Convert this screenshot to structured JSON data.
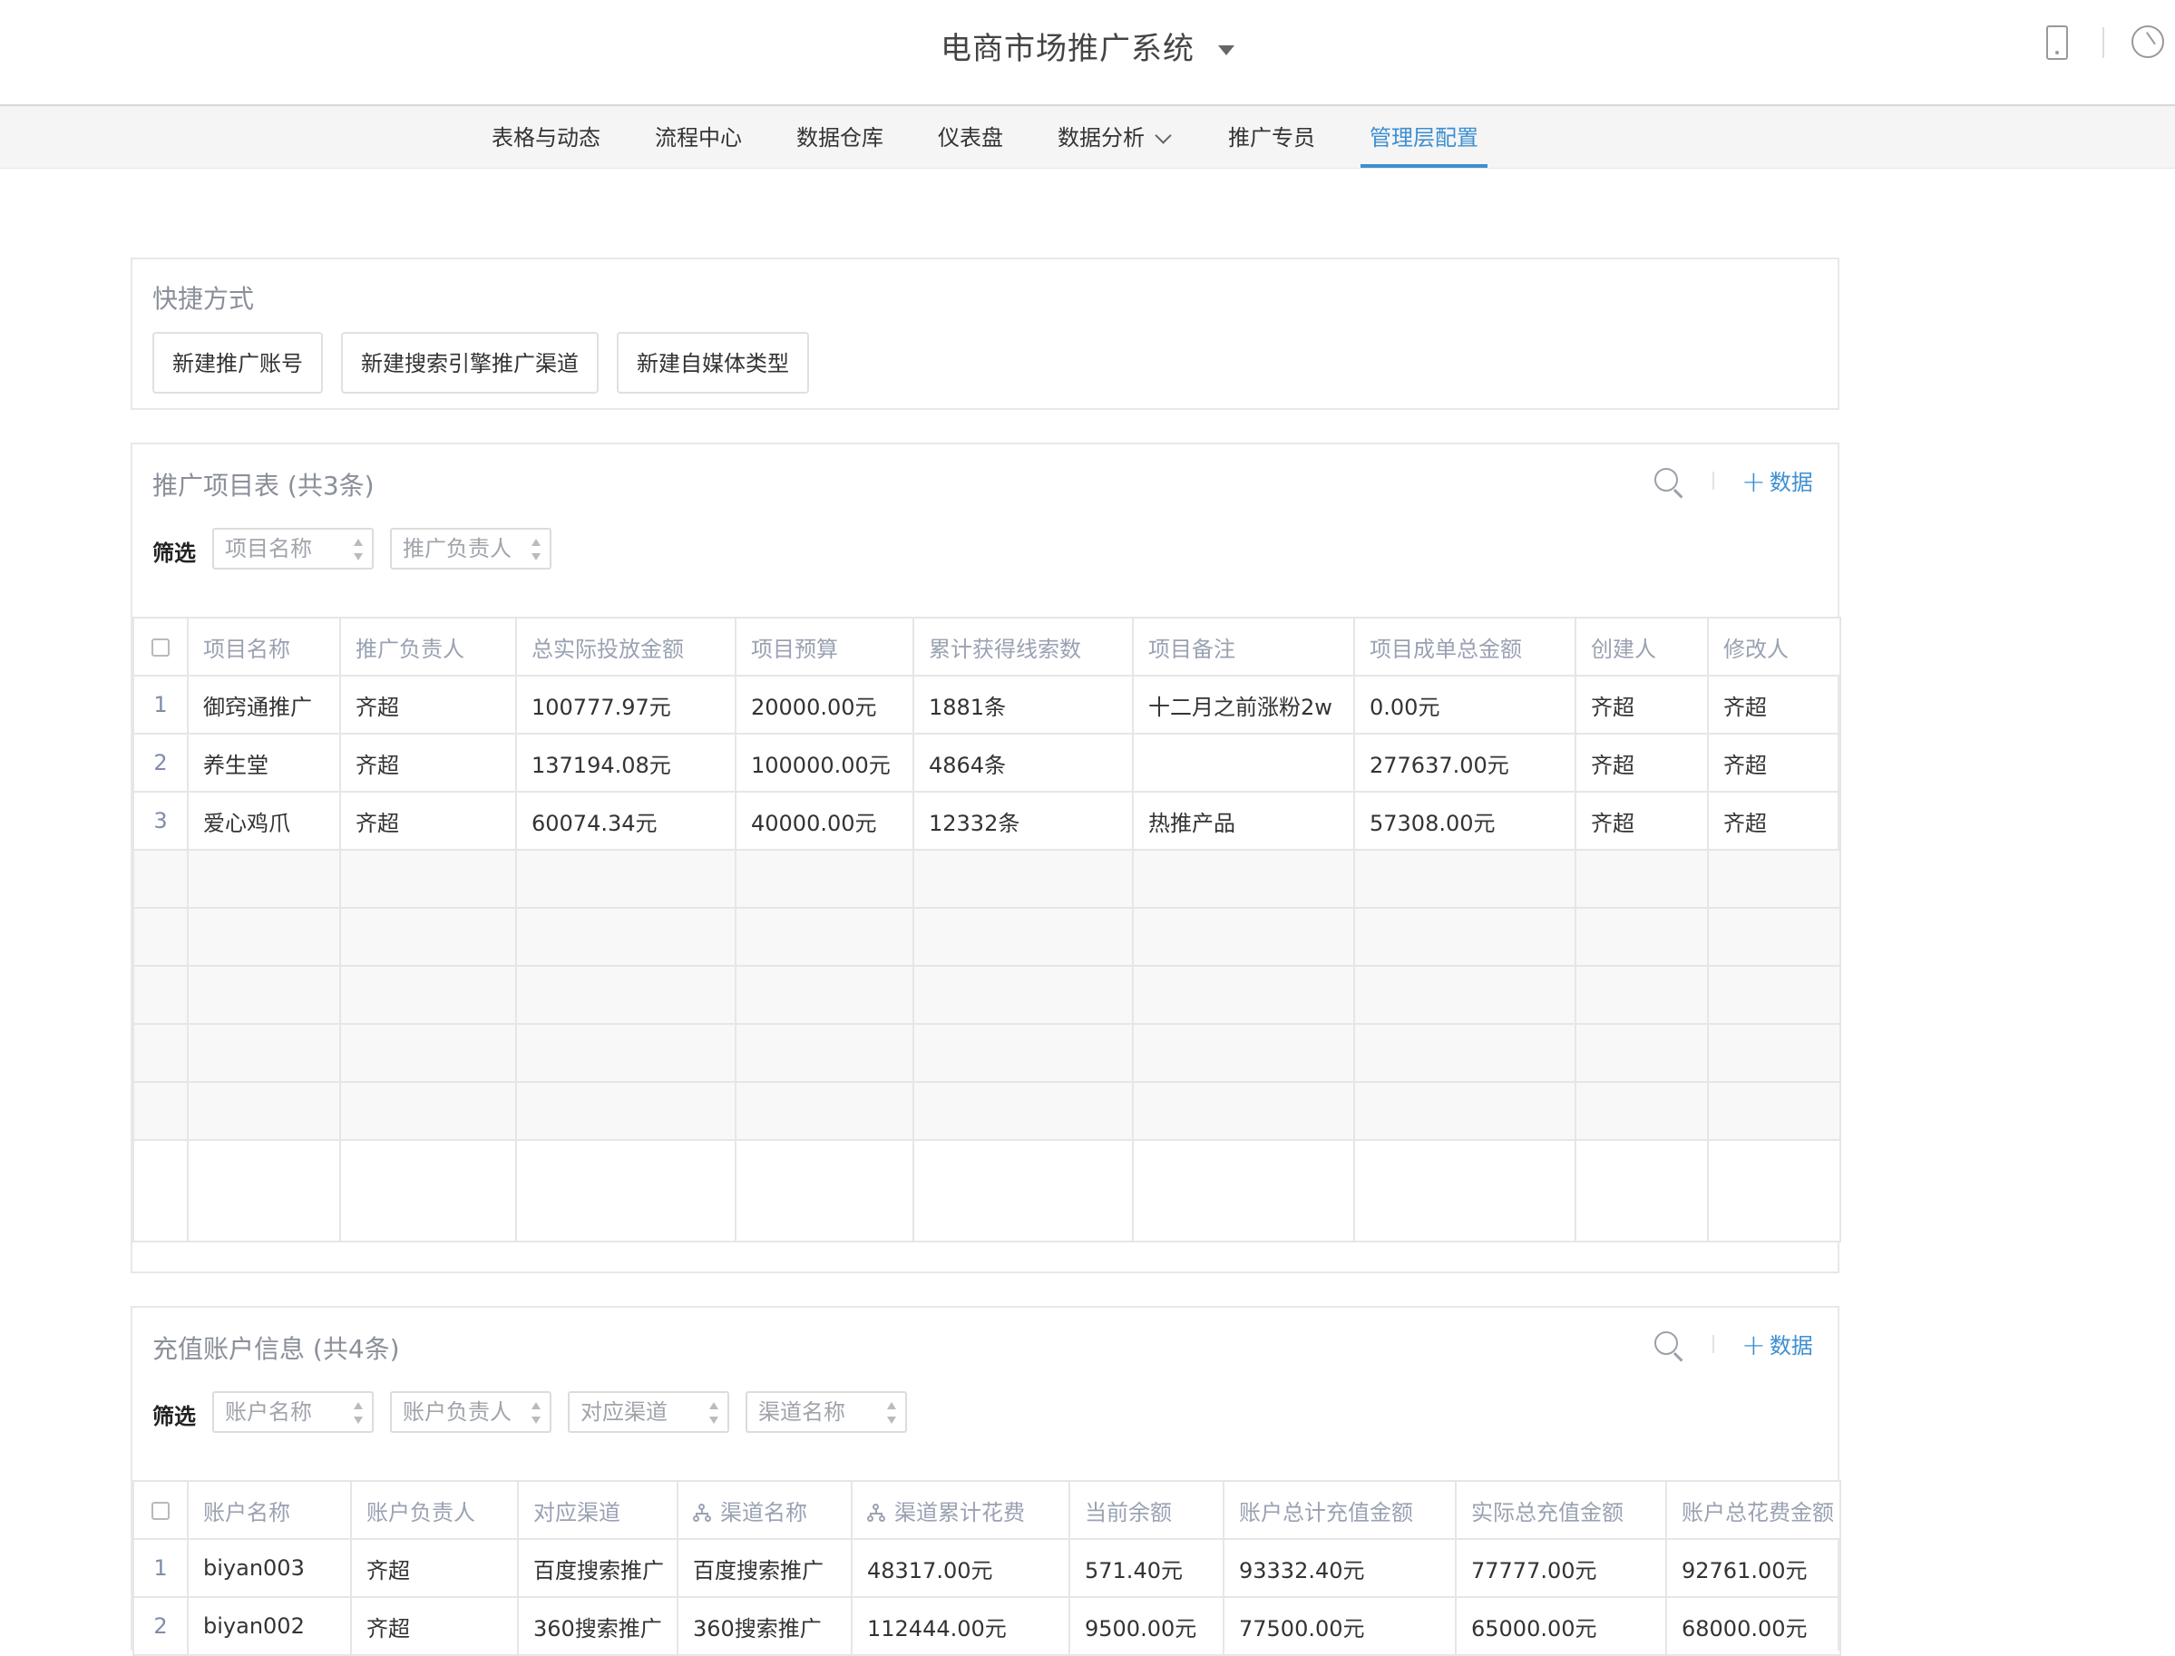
{
  "header": {
    "app_title": "电商市场推广系统"
  },
  "nav": {
    "items": [
      "表格与动态",
      "流程中心",
      "数据仓库",
      "仪表盘",
      "数据分析",
      "推广专员",
      "管理层配置"
    ],
    "active": "管理层配置",
    "accent_color": "#3d8fd1"
  },
  "shortcuts": {
    "title": "快捷方式",
    "buttons": [
      "新建推广账号",
      "新建搜索引擎推广渠道",
      "新建自媒体类型"
    ]
  },
  "projects": {
    "title": "推广项目表 (共3条)",
    "add_label": "数据",
    "filter_label": "筛选",
    "filters": [
      "项目名称",
      "推广负责人"
    ],
    "columns": [
      "项目名称",
      "推广负责人",
      "总实际投放金额",
      "项目预算",
      "累计获得线索数",
      "项目备注",
      "项目成单总金额",
      "创建人",
      "修改人"
    ],
    "rows": [
      {
        "idx": "1",
        "cells": [
          "御窍通推广",
          "齐超",
          "100777.97元",
          "20000.00元",
          "1881条",
          "十二月之前涨粉2w",
          "0.00元",
          "齐超",
          "齐超"
        ]
      },
      {
        "idx": "2",
        "cells": [
          "养生堂",
          "齐超",
          "137194.08元",
          "100000.00元",
          "4864条",
          "",
          "277637.00元",
          "齐超",
          "齐超"
        ]
      },
      {
        "idx": "3",
        "cells": [
          "爱心鸡爪",
          "齐超",
          "60074.34元",
          "40000.00元",
          "12332条",
          "热推产品",
          "57308.00元",
          "齐超",
          "齐超"
        ]
      }
    ]
  },
  "accounts": {
    "title": "充值账户信息 (共4条)",
    "add_label": "数据",
    "filter_label": "筛选",
    "filters": [
      "账户名称",
      "账户负责人",
      "对应渠道",
      "渠道名称"
    ],
    "columns": [
      "账户名称",
      "账户负责人",
      "对应渠道",
      "渠道名称",
      "渠道累计花费",
      "当前余额",
      "账户总计充值金额",
      "实际总充值金额",
      "账户总花费金额"
    ],
    "rows": [
      {
        "idx": "1",
        "cells": [
          "biyan003",
          "齐超",
          "百度搜索推广",
          "百度搜索推广",
          "48317.00元",
          "571.40元",
          "93332.40元",
          "77777.00元",
          "92761.00元"
        ]
      },
      {
        "idx": "2",
        "cells": [
          "biyan002",
          "齐超",
          "360搜索推广",
          "360搜索推广",
          "112444.00元",
          "9500.00元",
          "77500.00元",
          "65000.00元",
          "68000.00元"
        ]
      }
    ]
  }
}
